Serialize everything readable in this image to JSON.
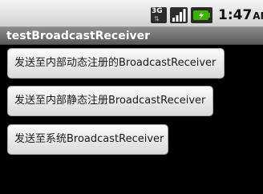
{
  "status_bar": {
    "network_type": "3G",
    "time": "1:47",
    "ampm": "AM",
    "icons": [
      "3g-icon",
      "signal-icon",
      "battery-icon"
    ]
  },
  "app": {
    "title": "testBroadcastReceiver"
  },
  "buttons": [
    {
      "label": "发送至内部动态注册的BroadcastReceiver"
    },
    {
      "label": "发送至内部静态注册BroadcastReceiver"
    },
    {
      "label": "发送至系统BroadcastReceiver"
    }
  ],
  "colors": {
    "background": "#000000",
    "battery_accent": "#3fb000"
  }
}
